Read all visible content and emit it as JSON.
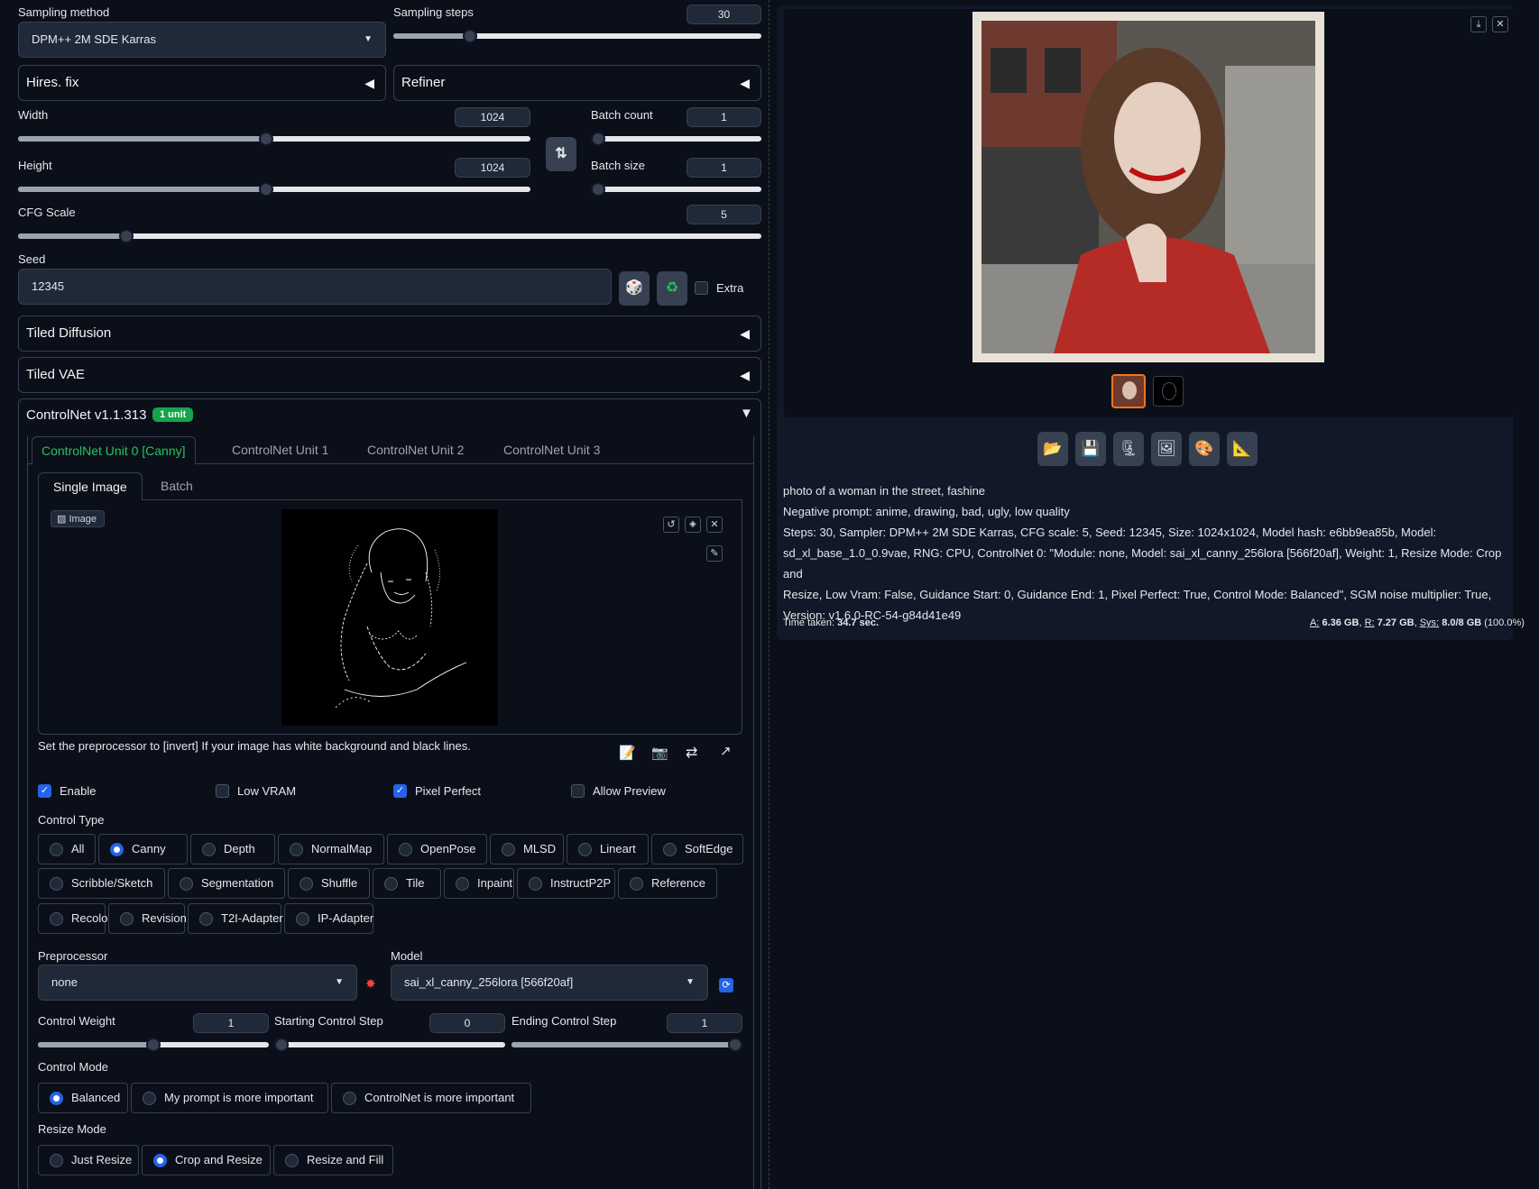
{
  "sampling": {
    "method_label": "Sampling method",
    "method_value": "DPM++ 2M SDE Karras",
    "steps_label": "Sampling steps",
    "steps_value": "30",
    "steps_fraction": 0.2
  },
  "accordions": {
    "hires": "Hires. fix",
    "refiner": "Refiner",
    "tiled_diffusion": "Tiled Diffusion",
    "tiled_vae": "Tiled VAE"
  },
  "dims": {
    "width_label": "Width",
    "width_value": "1024",
    "height_label": "Height",
    "height_value": "1024",
    "batch_count_label": "Batch count",
    "batch_count_value": "1",
    "batch_size_label": "Batch size",
    "batch_size_value": "1",
    "cfg_label": "CFG Scale",
    "cfg_value": "5",
    "swap_icon": "⇅"
  },
  "seed": {
    "label": "Seed",
    "value": "12345",
    "extra_label": "Extra",
    "dice_icon": "🎲",
    "recycle_icon": "♻"
  },
  "controlnet": {
    "title": "ControlNet v1.1.313",
    "badge": "1 unit",
    "tabs": [
      "ControlNet Unit 0 [Canny]",
      "ControlNet Unit 1",
      "ControlNet Unit 2",
      "ControlNet Unit 3"
    ],
    "subtabs": [
      "Single Image",
      "Batch"
    ],
    "image_label": "Image",
    "hint": "Set the preprocessor to [invert] If your image has white background and black lines.",
    "enable_label": "Enable",
    "lowvram_label": "Low VRAM",
    "pixelperfect_label": "Pixel Perfect",
    "allowpreview_label": "Allow Preview",
    "control_type_label": "Control Type",
    "control_types": [
      "All",
      "Canny",
      "Depth",
      "NormalMap",
      "OpenPose",
      "MLSD",
      "Lineart",
      "SoftEdge",
      "Scribble/Sketch",
      "Segmentation",
      "Shuffle",
      "Tile",
      "Inpaint",
      "InstructP2P",
      "Reference",
      "Recolor",
      "Revision",
      "T2I-Adapter",
      "IP-Adapter"
    ],
    "control_type_selected": "Canny",
    "preprocessor_label": "Preprocessor",
    "preprocessor_value": "none",
    "model_label": "Model",
    "model_value": "sai_xl_canny_256lora [566f20af]",
    "weight_label": "Control Weight",
    "weight_value": "1",
    "start_label": "Starting Control Step",
    "start_value": "0",
    "end_label": "Ending Control Step",
    "end_value": "1",
    "mode_label": "Control Mode",
    "modes": [
      "Balanced",
      "My prompt is more important",
      "ControlNet is more important"
    ],
    "mode_selected": "Balanced",
    "resize_label": "Resize Mode",
    "resizes": [
      "Just Resize",
      "Crop and Resize",
      "Resize and Fill"
    ],
    "resize_selected": "Crop and Resize"
  },
  "output": {
    "prompt": "photo of a woman in the street, fashine",
    "negative": "Negative prompt: anime, drawing, bad, ugly, low quality",
    "params_1": "Steps: 30, Sampler: DPM++ 2M SDE Karras, CFG scale: 5, Seed: 12345, Size: 1024x1024, Model hash: e6bb9ea85b, Model:",
    "params_2": "sd_xl_base_1.0_0.9vae, RNG: CPU, ControlNet 0: \"Module: none, Model: sai_xl_canny_256lora [566f20af], Weight: 1, Resize Mode: Crop and",
    "params_3": "Resize, Low Vram: False, Guidance Start: 0, Guidance End: 1, Pixel Perfect: True, Control Mode: Balanced\", SGM noise multiplier: True,",
    "params_4": "Version: v1.6.0-RC-54-g84d41e49",
    "time_label": "Time taken:",
    "time_value": "34.7 sec.",
    "vram_a_label": "A:",
    "vram_a": "6.36 GB",
    "vram_r_label": "R:",
    "vram_r": "7.27 GB",
    "vram_sys_label": "Sys:",
    "vram_sys": "8.0/8 GB",
    "vram_pct": "(100.0%)"
  },
  "colors": {
    "accent": "#2563eb",
    "badge": "#16a34a",
    "active_tab": "#22c55e",
    "selected_thumb": "#f97316"
  }
}
